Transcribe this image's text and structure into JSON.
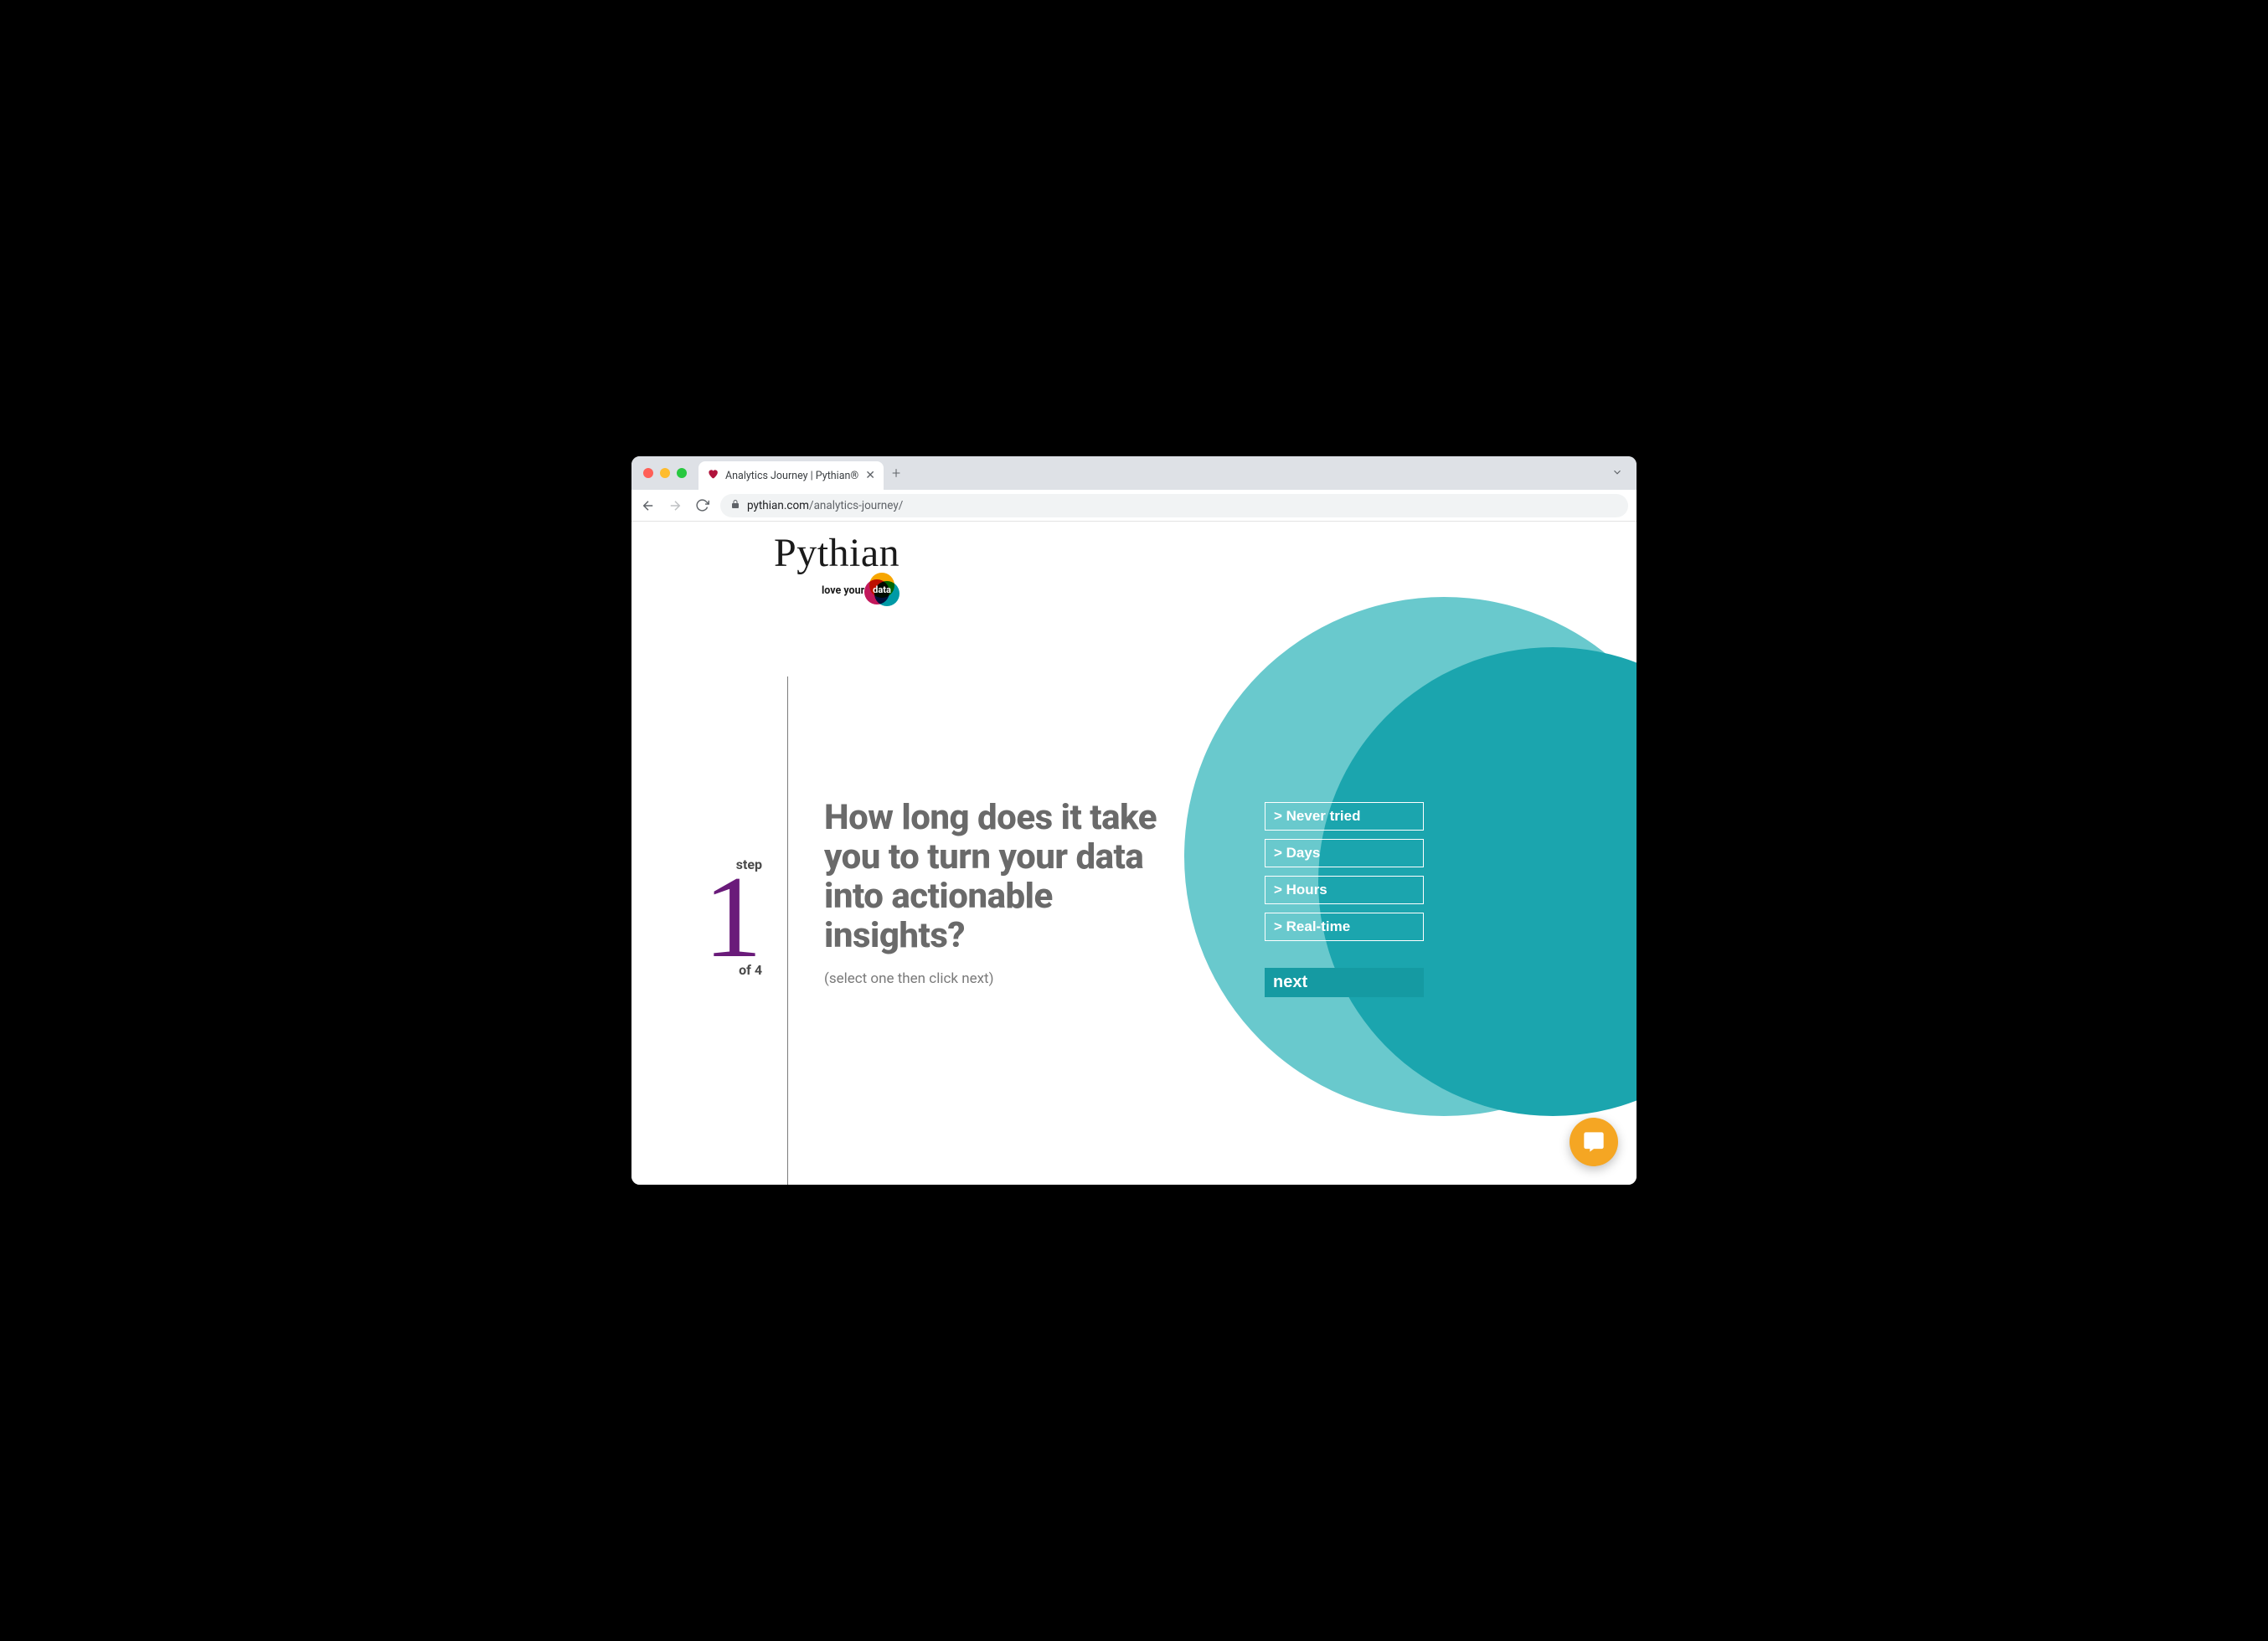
{
  "browser": {
    "tab_title": "Analytics Journey | Pythian®",
    "url_host": "pythian.com",
    "url_path": "/analytics-journey/"
  },
  "logo": {
    "brand": "Pythian",
    "tagline_prefix": "love your",
    "tagline_word": "data"
  },
  "step": {
    "label": "step",
    "number": "1",
    "of": "of 4"
  },
  "question": "How long does it take you to turn your data into actionable insights?",
  "hint": "(select one then click next)",
  "options": [
    "> Never tried",
    "> Days",
    "> Hours",
    "> Real-time"
  ],
  "next_label": "next"
}
